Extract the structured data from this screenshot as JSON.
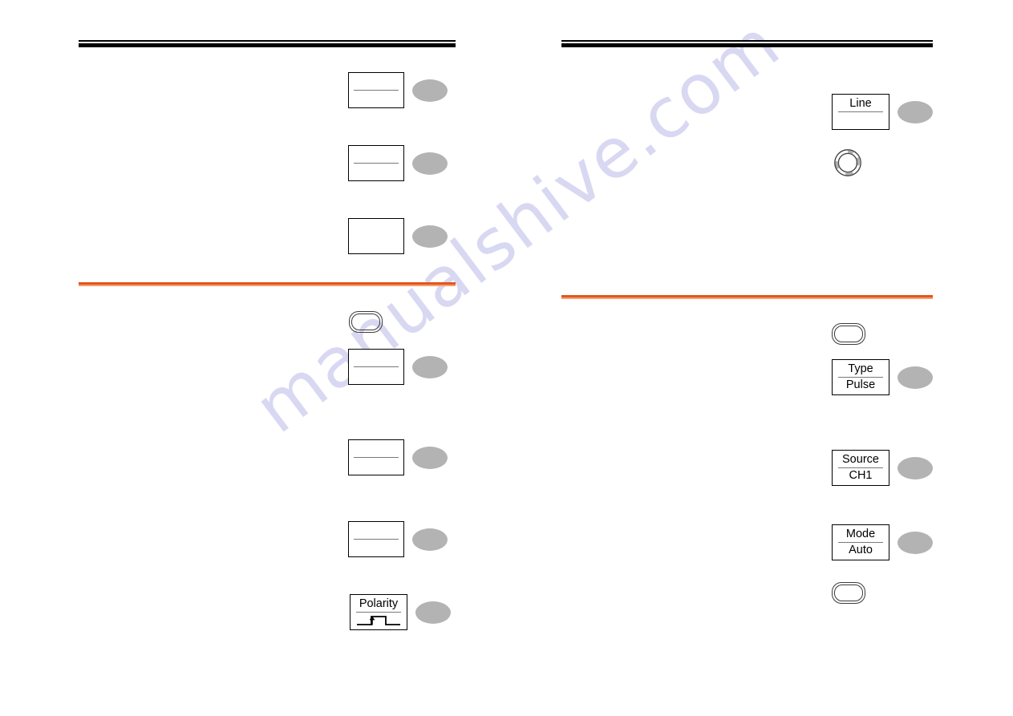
{
  "document": {
    "watermark_text": "manualshive.com",
    "accent_orange": "#e2561c",
    "accent_orange_light": "#f4a071",
    "softkey_ellipse_color": "#b3b3b3"
  },
  "left_column": {
    "section_one": {
      "softkeys": [
        {
          "name": "softkey-1",
          "top_label": "",
          "bottom_label": "",
          "has_divider": true
        },
        {
          "name": "softkey-2",
          "top_label": "",
          "bottom_label": "",
          "has_divider": true
        },
        {
          "name": "softkey-3",
          "top_label": "",
          "bottom_label": "",
          "has_divider": false
        }
      ]
    },
    "section_two": {
      "panel_button_label": "",
      "softkeys": [
        {
          "name": "softkey-4",
          "top_label": "",
          "bottom_label": "",
          "has_divider": true
        },
        {
          "name": "softkey-5",
          "top_label": "",
          "bottom_label": "",
          "has_divider": true
        },
        {
          "name": "softkey-6",
          "top_label": "",
          "bottom_label": "",
          "has_divider": true
        },
        {
          "name": "softkey-polarity",
          "top_label": "Polarity",
          "bottom_label": "",
          "has_divider": true,
          "icon": "rising-edge-pulse-icon"
        }
      ]
    }
  },
  "right_column": {
    "section_one": {
      "softkeys": [
        {
          "name": "softkey-line",
          "top_label": "Line",
          "bottom_label": "",
          "has_divider": true
        }
      ],
      "knob": {
        "name": "rotary-knob-icon"
      }
    },
    "section_two": {
      "panel_button_top_label": "",
      "panel_button_bottom_label": "",
      "softkeys": [
        {
          "name": "softkey-type",
          "top_label": "Type",
          "bottom_label": "Pulse",
          "has_divider": true
        },
        {
          "name": "softkey-source",
          "top_label": "Source",
          "bottom_label": "CH1",
          "has_divider": true
        },
        {
          "name": "softkey-mode",
          "top_label": "Mode",
          "bottom_label": "Auto",
          "has_divider": true
        }
      ]
    }
  }
}
